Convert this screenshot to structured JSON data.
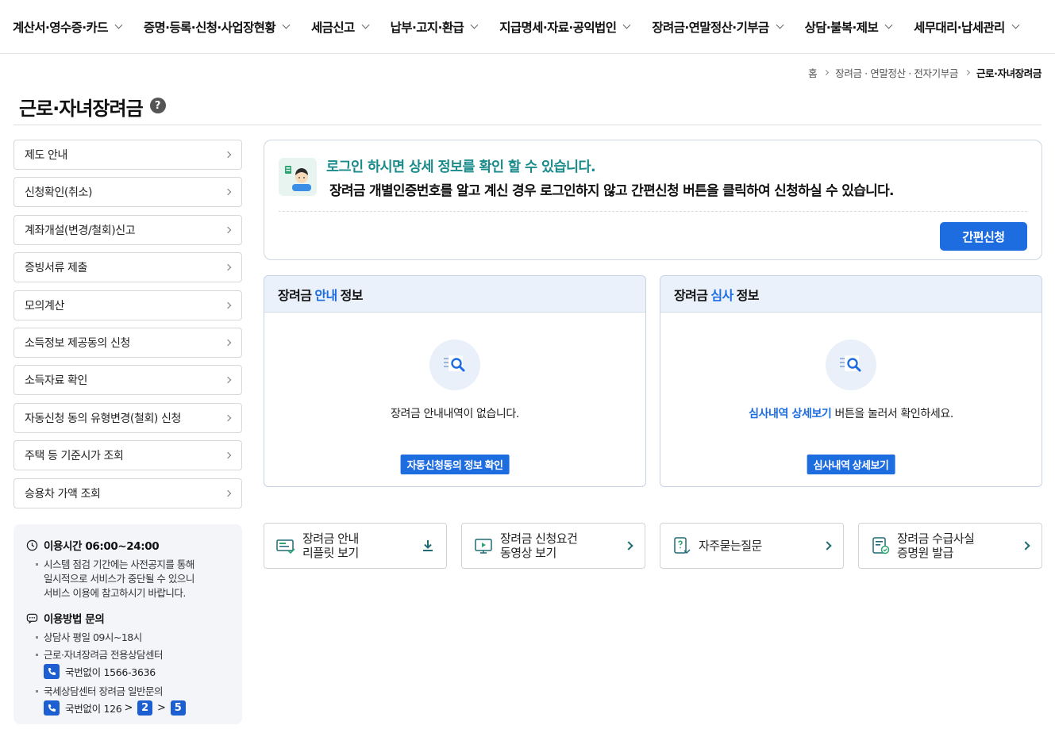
{
  "nav": {
    "items": [
      {
        "label": "계산서·영수증·카드"
      },
      {
        "label": "증명·등록·신청·사업장현황"
      },
      {
        "label": "세금신고"
      },
      {
        "label": "납부·고지·환급"
      },
      {
        "label": "지급명세·자료·공익법인"
      },
      {
        "label": "장려금·연말정산·기부금"
      },
      {
        "label": "상담·불복·제보"
      },
      {
        "label": "세무대리·납세관리"
      }
    ]
  },
  "breadcrumb": {
    "home": "홈",
    "level1": "장려금 · 연말정산 · 전자기부금",
    "current": "근로·자녀장려금"
  },
  "page": {
    "title": "근로·자녀장려금",
    "help": "?"
  },
  "side_menu": {
    "items": [
      {
        "label": "제도 안내"
      },
      {
        "label": "신청확인(취소)"
      },
      {
        "label": "계좌개설(변경/철회)신고"
      },
      {
        "label": "증빙서류 제출"
      },
      {
        "label": "모의계산"
      },
      {
        "label": "소득정보 제공동의 신청"
      },
      {
        "label": "소득자료 확인"
      },
      {
        "label": "자동신청 동의 유형변경(철회) 신청"
      },
      {
        "label": "주택 등 기준시가 조회"
      },
      {
        "label": "승용차 가액 조회"
      }
    ]
  },
  "info": {
    "hours_title": "이용시간 06:00~24:00",
    "hours_desc1": "시스템 점검 기간에는 사전공지를 통해",
    "hours_desc2": "일시적으로 서비스가 중단될 수 있으니",
    "hours_desc3": "서비스 이용에 참고하시기 바랍니다.",
    "inquiry_title": "이용방법 문의",
    "line1": "상담사 평일 09시~18시",
    "line2": "근로·자녀장려금 전용상담센터",
    "phone1": "국번없이 1566-3636",
    "line3": "국세상담센터 장려금 일반문의",
    "phone2": "국번없이 126",
    "step1": "2",
    "step2": "5",
    "gt": ">"
  },
  "notice": {
    "title": "로그인 하시면 상세 정보를 확인 할 수 있습니다.",
    "desc": "장려금 개별인증번호를 알고 계신 경우 로그인하지 않고 간편신청 버튼을 클릭하여 신청하실 수 있습니다.",
    "button": "간편신청"
  },
  "panel_guide": {
    "title_pre": "장려금",
    "title_hl": "안내",
    "title_post": "정보",
    "message": "장려금 안내내역이 없습니다.",
    "button": "자동신청동의 정보 확인"
  },
  "panel_review": {
    "title_pre": "장려금",
    "title_hl": "심사",
    "title_post": "정보",
    "message_link": "심사내역 상세보기",
    "message_rest": " 버튼을 눌러서 확인하세요.",
    "button": "심사내역 상세보기"
  },
  "quick_links": [
    {
      "label": "장려금 안내\n리플릿 보기",
      "icon": "leaflet-icon",
      "action": "download-icon"
    },
    {
      "label": "장려금 신청요건\n동영상 보기",
      "icon": "video-icon",
      "action": "chevron-right-icon"
    },
    {
      "label": "자주묻는질문",
      "icon": "faq-icon",
      "action": "chevron-right-icon"
    },
    {
      "label": "장려금 수급사실\n증명원 발급",
      "icon": "certificate-icon",
      "action": "chevron-right-icon"
    }
  ],
  "colors": {
    "primary": "#1d6ce0",
    "teal": "#1a8a8a",
    "panel_head_bg": "#eaf1fb"
  }
}
